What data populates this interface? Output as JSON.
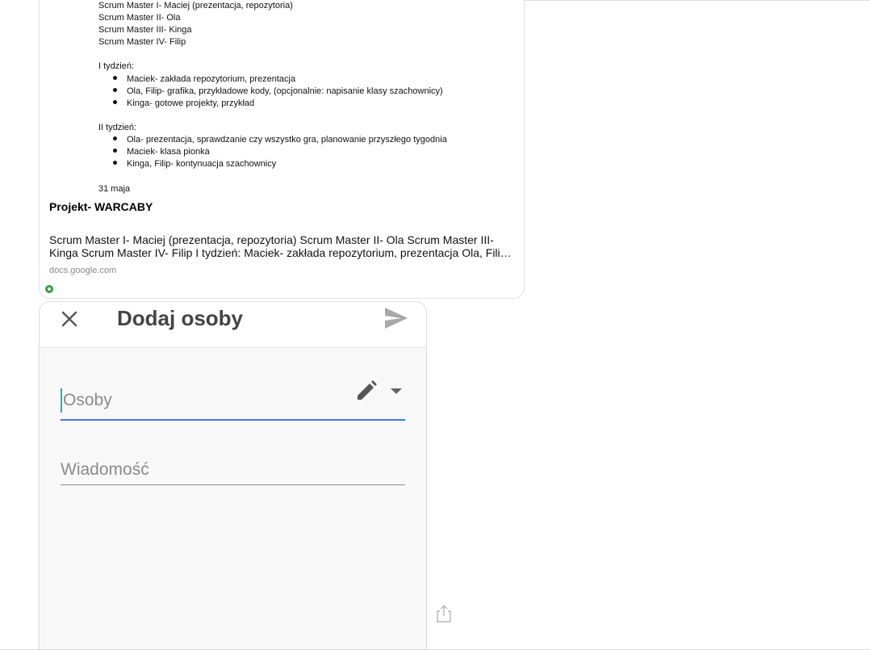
{
  "link_preview": {
    "document_lines": {
      "sm1": "Scrum Master I- Maciej (prezentacja, repozytoria)",
      "sm2": "Scrum Master II- Ola",
      "sm3": "Scrum Master III- Kinga",
      "sm4": "Scrum Master IV- Filip",
      "week1_heading": "I tydzień:",
      "week1_items": [
        "Maciek- zakłada repozytorium, prezentacja",
        "Ola, Filip- grafika, przykładowe kody, (opcjonalnie: napisanie klasy szachownicy)",
        "Kinga- gotowe projekty, przykład"
      ],
      "week2_heading": "II tydzień:",
      "week2_items": [
        "Ola- prezentacja, sprawdzanie czy wszystko gra, planowanie przyszłego tygodnia",
        "Maciek- klasa pionka",
        "Kinga, Filip- kontynuacja szachownicy"
      ],
      "date": "31 maja"
    },
    "title": "Projekt- WARCABY",
    "description": "Scrum Master I- Maciej (prezentacja, repozytoria) Scrum Master II- Ola Scrum Master III- Kinga Scrum Master IV- Filip I tydzień: Maciek- zakłada repozytorium, prezentacja Ola, Filip- grafika, przykładowe kody",
    "domain": "docs.google.com",
    "status_color": "#2f9e44"
  },
  "share_dialog": {
    "title": "Dodaj osoby",
    "close_icon": "close-icon",
    "send_icon": "send-icon",
    "people_placeholder": "Osoby",
    "people_value": "",
    "edit_icon": "pencil-icon",
    "dropdown_icon": "caret-down-icon",
    "message_placeholder": "Wiadomość",
    "message_value": "",
    "accent_color": "#3b78e7"
  },
  "share_icon": "share-icon"
}
